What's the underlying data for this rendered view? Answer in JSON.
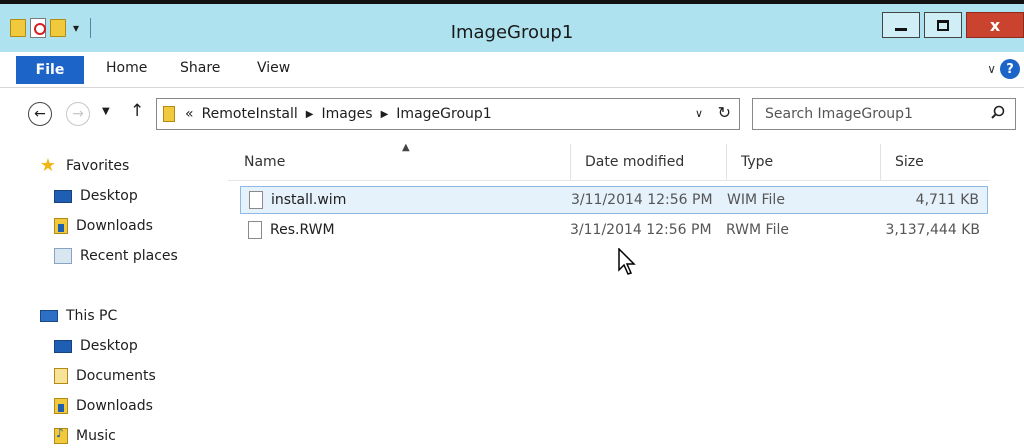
{
  "window": {
    "title": "ImageGroup1",
    "controls": {
      "minimize": "–",
      "maximize": "□",
      "close": "x"
    }
  },
  "ribbon": {
    "file_tab": "File",
    "tabs": [
      "Home",
      "Share",
      "View"
    ],
    "expand_glyph": "∨",
    "help_glyph": "?"
  },
  "address": {
    "prefix": "«",
    "segments": [
      "RemoteInstall",
      "Images",
      "ImageGroup1"
    ],
    "search_placeholder": "Search ImageGroup1"
  },
  "nav_pane": {
    "favorites": {
      "label": "Favorites",
      "items": [
        "Desktop",
        "Downloads",
        "Recent places"
      ]
    },
    "this_pc": {
      "label": "This PC",
      "items": [
        "Desktop",
        "Documents",
        "Downloads",
        "Music"
      ]
    }
  },
  "columns": [
    "Name",
    "Date modified",
    "Type",
    "Size"
  ],
  "files": [
    {
      "name": "install.wim",
      "date": "3/11/2014 12:56 PM",
      "type": "WIM File",
      "size": "4,711 KB",
      "selected": true
    },
    {
      "name": "Res.RWM",
      "date": "3/11/2014 12:56 PM",
      "type": "RWM File",
      "size": "3,137,444 KB",
      "selected": false
    }
  ],
  "icons": {
    "favorites": "star-icon",
    "desktop": "desktop-icon",
    "downloads": "downloads-icon",
    "recent": "recent-places-icon",
    "pc": "computer-icon",
    "documents": "documents-icon",
    "music": "music-icon",
    "file": "file-icon"
  },
  "colors": {
    "file_tab": "#1c64c8",
    "titlebar": "#aee2ef",
    "close": "#c9432e",
    "selection": "#e5f1fb"
  }
}
